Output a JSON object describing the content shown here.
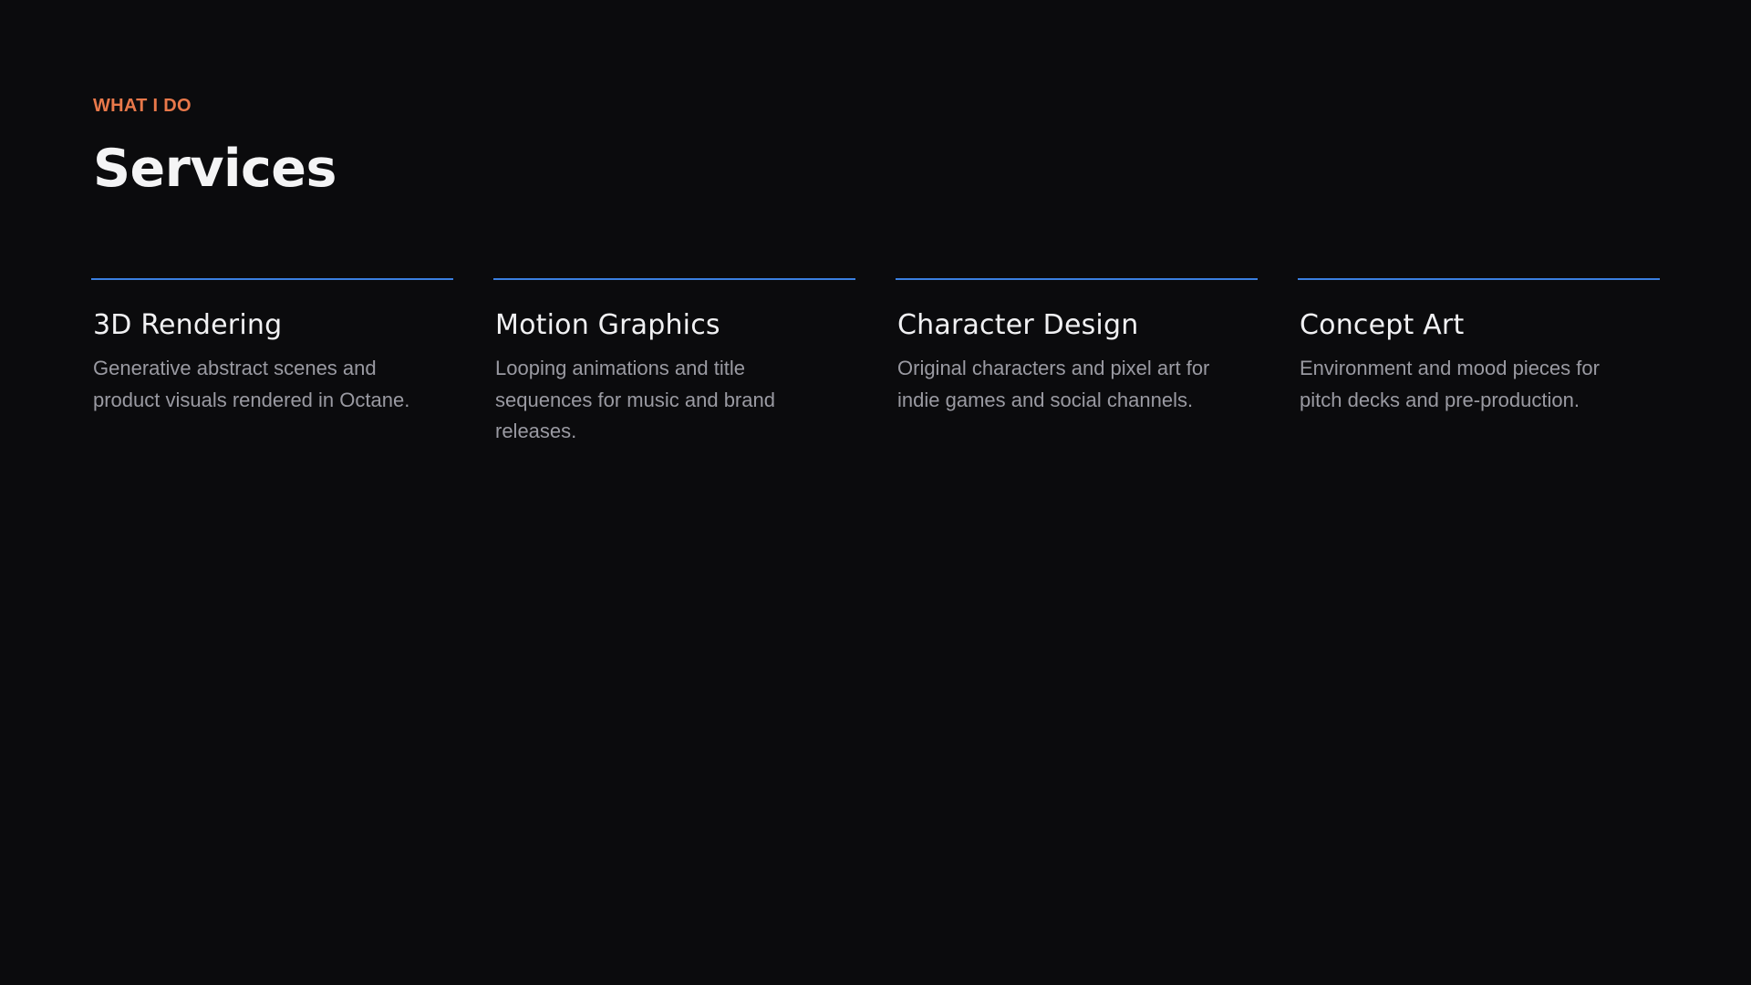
{
  "header": {
    "eyebrow": "WHAT I DO",
    "title": "Services"
  },
  "services": [
    {
      "name": "3D Rendering",
      "description": "Generative abstract scenes and product visuals rendered in Octane."
    },
    {
      "name": "Motion Graphics",
      "description": "Looping animations and title sequences for music and brand releases."
    },
    {
      "name": "Character Design",
      "description": "Original characters and pixel art for indie games and social channels."
    },
    {
      "name": "Concept Art",
      "description": "Environment and mood pieces for pitch decks and pre-production."
    }
  ],
  "colors": {
    "background": "#0b0b0d",
    "accent": "#e8784a",
    "rule": "#3b7fe0"
  }
}
